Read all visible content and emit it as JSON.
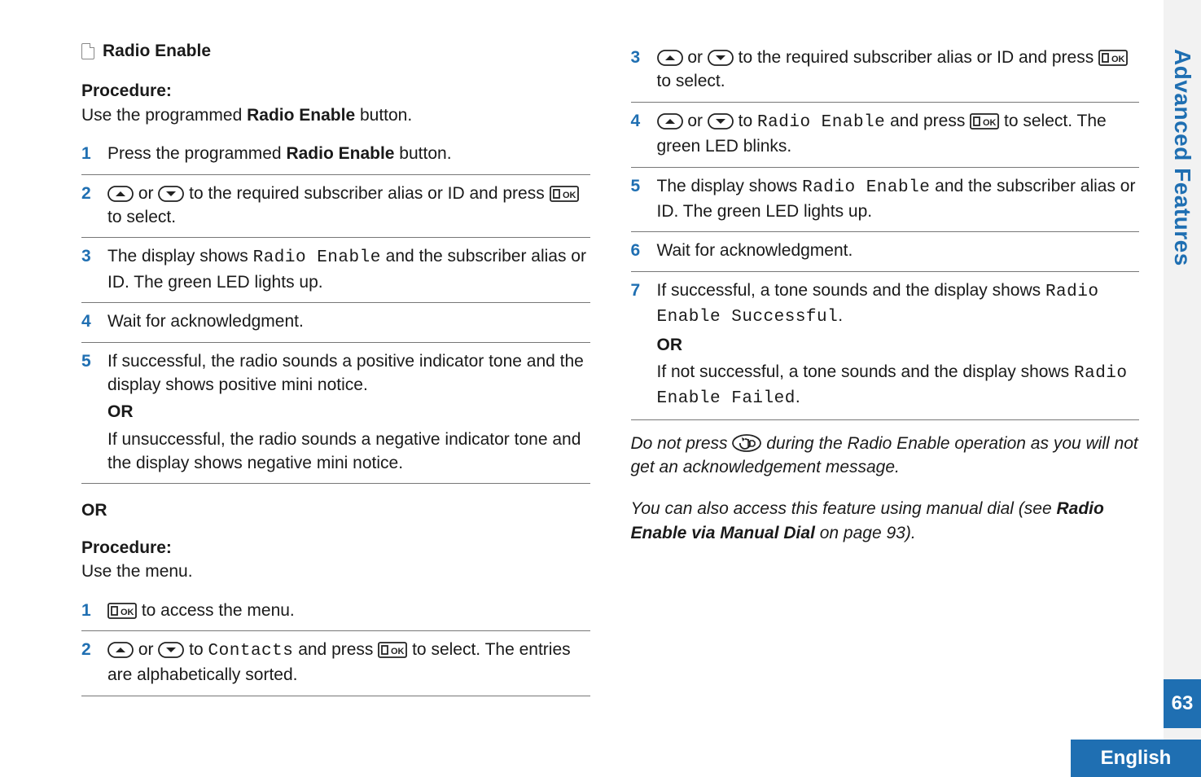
{
  "sidebar": {
    "chapter": "Advanced Features",
    "page_number": "63",
    "language": "English"
  },
  "left": {
    "heading": "Radio Enable",
    "proc_label_1": "Procedure:",
    "lead_1a": "Use the programmed ",
    "lead_1b": "Radio Enable",
    "lead_1c": " button.",
    "steps_a": {
      "1": {
        "t1": "Press the programmed ",
        "b1": "Radio Enable",
        "t2": " button."
      },
      "2": {
        "t1": " or ",
        "t2": " to the required subscriber alias or ID and press ",
        "t3": " to select."
      },
      "3": {
        "t1": "The display shows ",
        "m1": "Radio Enable",
        "t2": " and the subscriber alias or ID. The green LED lights up."
      },
      "4": {
        "t1": "Wait for acknowledgment."
      },
      "5": {
        "t1": "If successful, the radio sounds a positive indicator tone and the display shows positive mini notice.",
        "or": "OR",
        "t2": "If unsuccessful, the radio sounds a negative indicator tone and the display shows negative mini notice."
      }
    },
    "or_block": "OR",
    "proc_label_2": "Procedure:",
    "lead_2": "Use the menu.",
    "steps_b": {
      "1": {
        "t1": " to access the menu."
      },
      "2": {
        "t1": " or ",
        "t2": " to ",
        "m1": "Contacts",
        "t3": " and press ",
        "t4": " to select. The entries are alphabetically sorted."
      }
    }
  },
  "right": {
    "steps": {
      "3": {
        "t1": " or ",
        "t2": " to the required subscriber alias or ID and press ",
        "t3": " to select."
      },
      "4": {
        "t1": " or ",
        "t2": " to ",
        "m1": "Radio Enable",
        "t3": " and press ",
        "t4": " to select. The green LED blinks."
      },
      "5": {
        "t1": "The display shows ",
        "m1": "Radio Enable",
        "t2": " and the subscriber alias or ID. The green LED lights up."
      },
      "6": {
        "t1": "Wait for acknowledgment."
      },
      "7": {
        "t1": "If successful, a tone sounds and the display shows ",
        "m1": "Radio Enable Successful",
        "t1b": ".",
        "or": "OR",
        "t2": "If not successful, a tone sounds and the display shows ",
        "m2": "Radio Enable Failed",
        "t2b": "."
      }
    },
    "note1a": "Do not press ",
    "note1b": " during the Radio Enable operation as you will not get an acknowledgement message.",
    "note2a": "You can also access this feature using manual dial (see ",
    "note2b": "Radio Enable via Manual Dial",
    "note2c": " on page 93)."
  },
  "step_numbers": {
    "n1": "1",
    "n2": "2",
    "n3": "3",
    "n4": "4",
    "n5": "5",
    "n6": "6",
    "n7": "7"
  }
}
